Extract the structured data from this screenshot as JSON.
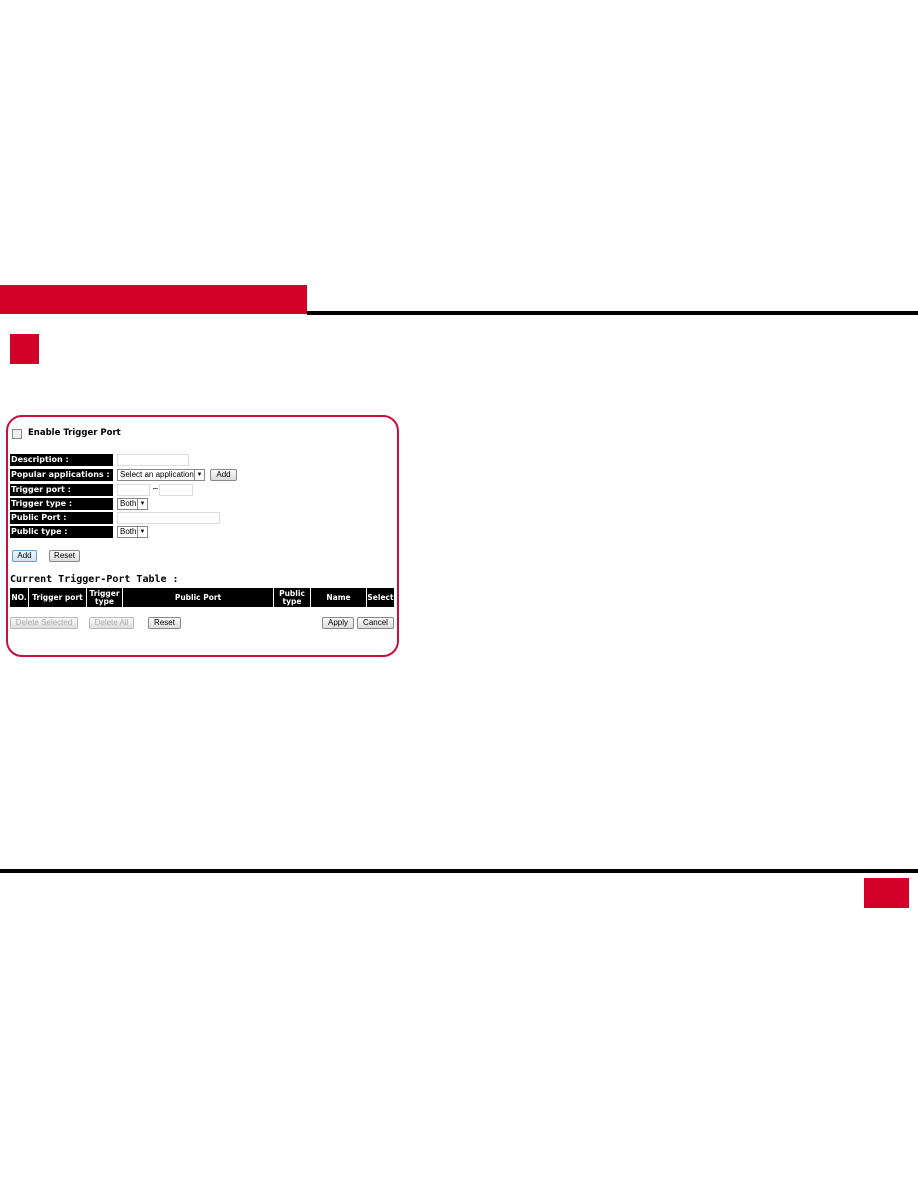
{
  "enable_label": "Enable Trigger Port",
  "fields": {
    "description": "Description :",
    "popular": "Popular applications :",
    "trigger_port": "Trigger port :",
    "trigger_type": "Trigger type :",
    "public_port": "Public Port :",
    "public_type": "Public type :"
  },
  "popular_select": "Select an application",
  "add_app": "Add",
  "tilde": "~",
  "trigger_type_value": "Both",
  "public_type_value": "Both",
  "add": "Add",
  "reset": "Reset",
  "table_title": "Current Trigger-Port Table :",
  "columns": [
    "NO.",
    "Trigger port",
    "Trigger type",
    "Public Port",
    "Public type",
    "Name",
    "Select"
  ],
  "buttons": {
    "delete_selected": "Delete Selected",
    "delete_all": "Delete All",
    "reset": "Reset",
    "apply": "Apply",
    "cancel": "Cancel"
  },
  "colors": {
    "accent": "#d3002a"
  }
}
